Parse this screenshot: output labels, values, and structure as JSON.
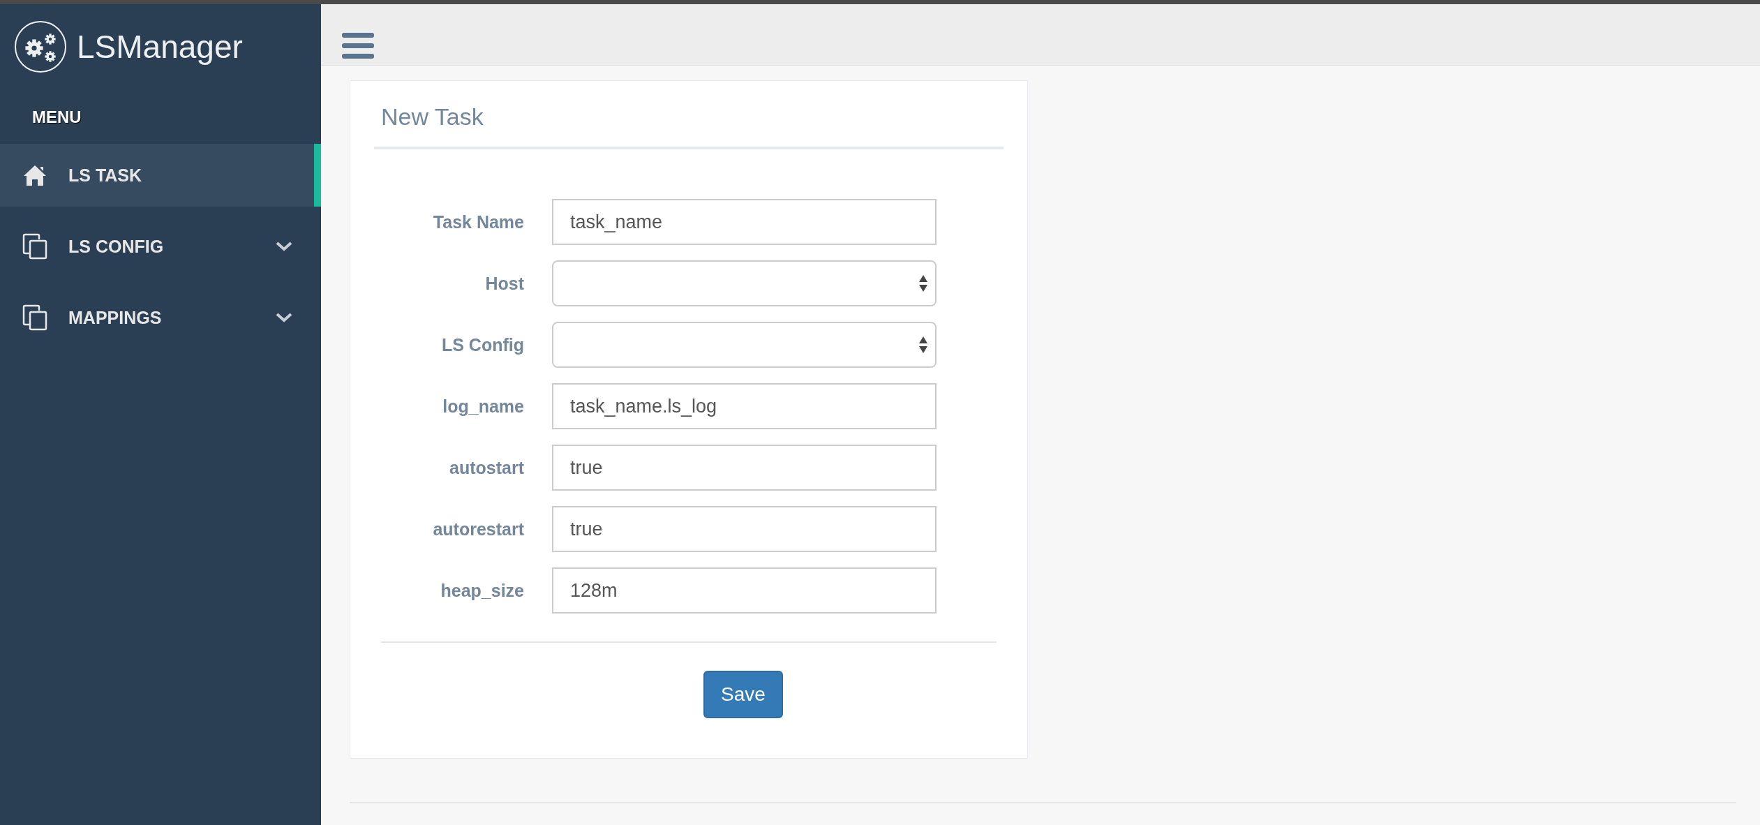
{
  "sidebar": {
    "brand": "LSManager",
    "menu_heading": "MENU",
    "items": [
      {
        "label": "LS TASK",
        "kind": "home",
        "selected": true,
        "expandable": false
      },
      {
        "label": "LS CONFIG",
        "kind": "copy",
        "selected": false,
        "expandable": true
      },
      {
        "label": "MAPPINGS",
        "kind": "copy",
        "selected": false,
        "expandable": true
      }
    ]
  },
  "form": {
    "title": "New Task",
    "fields": [
      {
        "label": "Task Name",
        "kind": "text",
        "value": "task_name"
      },
      {
        "label": "Host",
        "kind": "select"
      },
      {
        "label": "LS Config",
        "kind": "select"
      },
      {
        "label": "log_name",
        "kind": "text",
        "value": "task_name.ls_log"
      },
      {
        "label": "autostart",
        "kind": "text",
        "value": "true"
      },
      {
        "label": "autorestart",
        "kind": "text",
        "value": "true"
      },
      {
        "label": "heap_size",
        "kind": "text",
        "value": "128m"
      }
    ],
    "submit": "Save"
  }
}
